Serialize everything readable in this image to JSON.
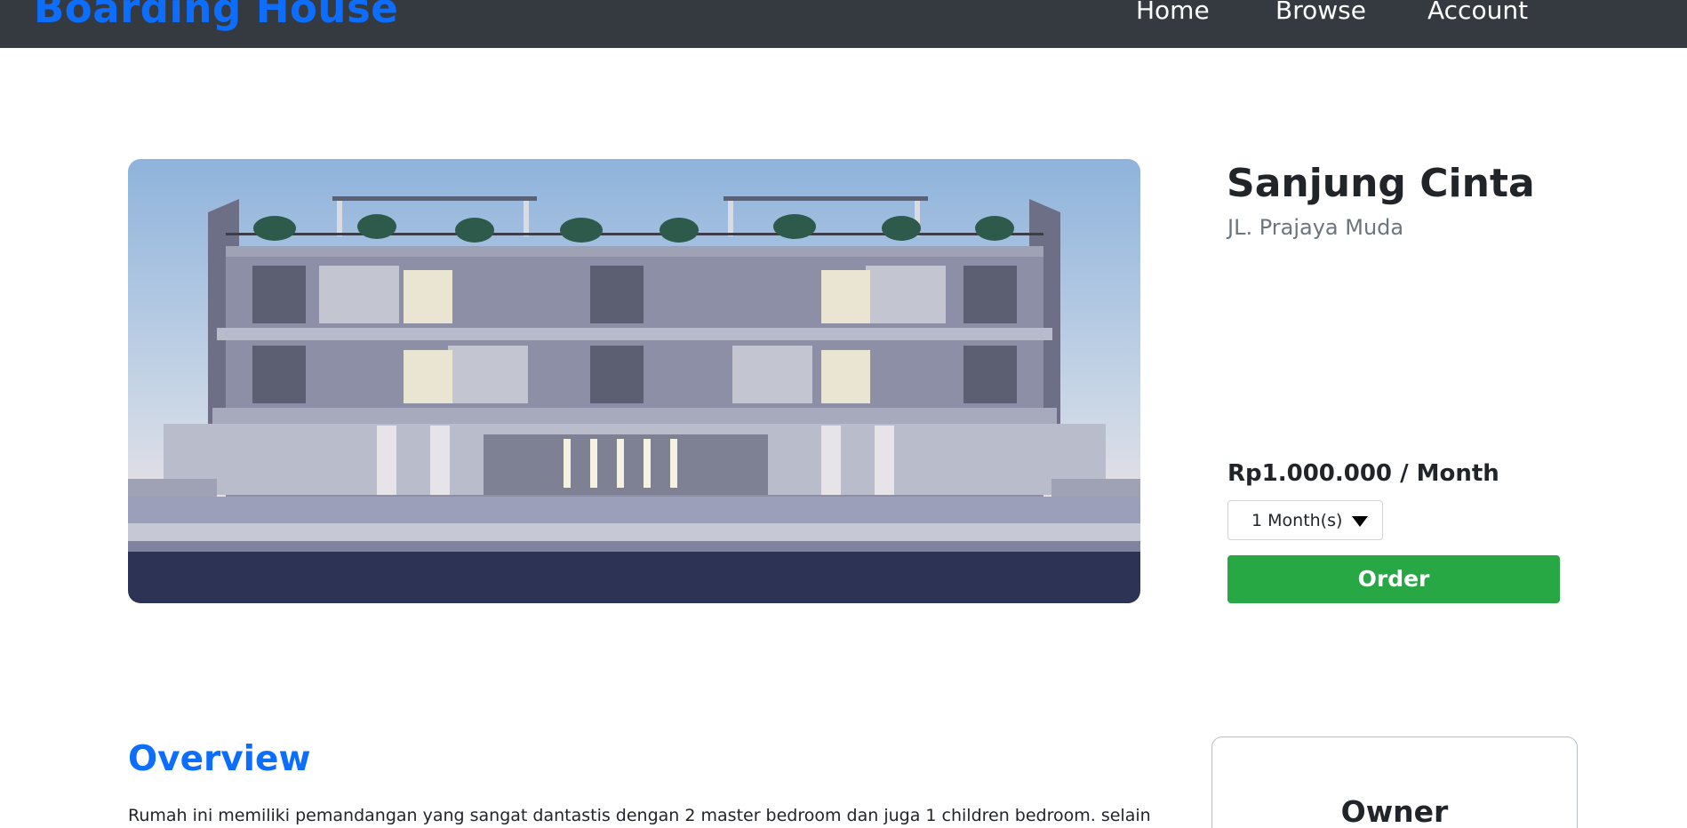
{
  "navbar": {
    "brand": "Boarding House",
    "links": [
      "Home",
      "Browse",
      "Account"
    ]
  },
  "listing": {
    "name": "Sanjung Cinta",
    "address": "JL. Prajaya Muda",
    "price": "Rp1.000.000 / Month",
    "duration_selected": "1 Month(s)",
    "order_label": "Order"
  },
  "overview": {
    "title": "Overview",
    "text": "Rumah ini memiliki pemandangan yang sangat dantastis dengan 2 master bedroom dan juga 1 children bedroom. selain itu,"
  },
  "owner_card": {
    "title": "Owner"
  },
  "colors": {
    "navbar_bg": "#343a40",
    "brand": "#0d6efd",
    "order_button": "#28a745",
    "muted_text": "#6c757d"
  }
}
